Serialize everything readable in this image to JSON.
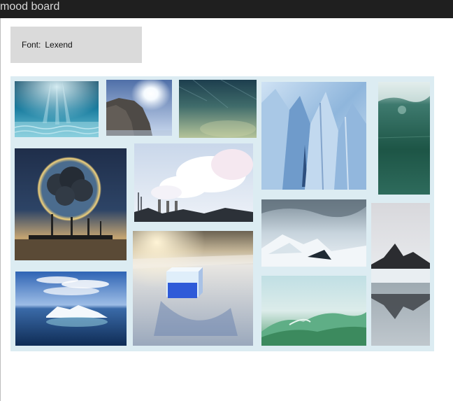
{
  "window": {
    "title": "mood board"
  },
  "font_card": {
    "label": "Font:",
    "value": "Lexend"
  },
  "board": {
    "background": "#dcecf2",
    "images": [
      {
        "name": "underwater-light"
      },
      {
        "name": "cliff-sun"
      },
      {
        "name": "green-water"
      },
      {
        "name": "glacier-ice"
      },
      {
        "name": "green-underwater"
      },
      {
        "name": "earth-smoke-art"
      },
      {
        "name": "factory-steam"
      },
      {
        "name": "stormy-ice-sea"
      },
      {
        "name": "mountain-reflection"
      },
      {
        "name": "ice-cube-snow"
      },
      {
        "name": "iceberg-sea"
      },
      {
        "name": "green-wave"
      }
    ]
  }
}
